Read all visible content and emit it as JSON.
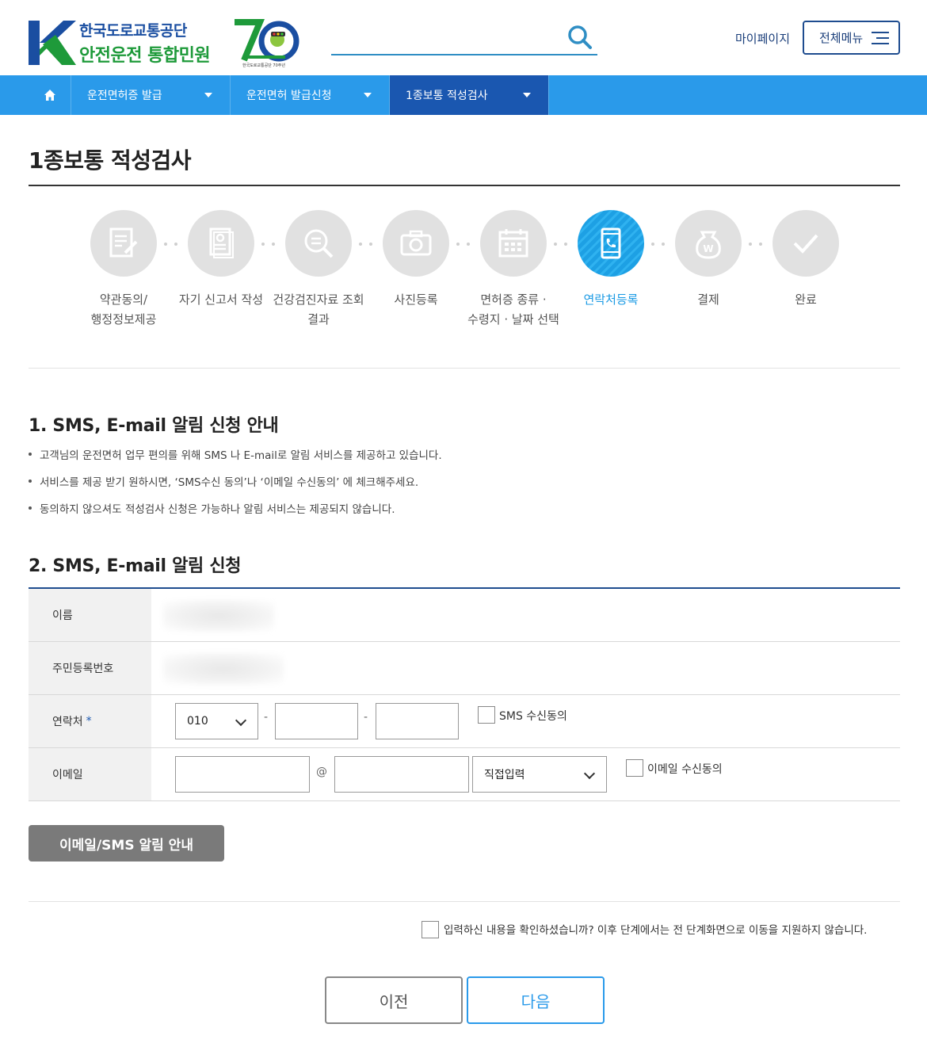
{
  "header": {
    "org_name": "한국도로교통공단",
    "service_name": "안전운전 통합민원",
    "anniversary_small": "한국도로교통공단 70주년",
    "search": {
      "value": "",
      "placeholder": ""
    },
    "mypage_label": "마이페이지",
    "allmenu_label": "전체메뉴"
  },
  "nav": {
    "items": [
      {
        "label": "운전면허증 발급"
      },
      {
        "label": "운전면허 발급신청"
      },
      {
        "label": "1종보통 적성검사"
      }
    ]
  },
  "page_title": "1종보통 적성검사",
  "steps": [
    {
      "label_line1": "약관동의/",
      "label_line2": "행정정보제공",
      "icon": "document-pen-icon"
    },
    {
      "label_line1": "자기 신고서 작성",
      "label_line2": "",
      "icon": "form-person-icon"
    },
    {
      "label_line1": "건강검진자료 조회",
      "label_line2": "결과",
      "icon": "search-document-icon"
    },
    {
      "label_line1": "사진등록",
      "label_line2": "",
      "icon": "camera-icon"
    },
    {
      "label_line1": "면허증 종류 ·",
      "label_line2": "수령지 · 날짜 선택",
      "icon": "calendar-icon"
    },
    {
      "label_line1": "연락처등록",
      "label_line2": "",
      "icon": "phone-icon"
    },
    {
      "label_line1": "결제",
      "label_line2": "",
      "icon": "won-bag-icon"
    },
    {
      "label_line1": "완료",
      "label_line2": "",
      "icon": "check-icon"
    }
  ],
  "active_step": 6,
  "section1": {
    "title": "1. SMS, E-mail 알림 신청 안내",
    "bullets": [
      "고객님의 운전면허 업무 편의를 위해 SMS 나 E-mail로 알림 서비스를 제공하고 있습니다.",
      "서비스를 제공 받기 원하시면, ‘SMS수신 동의’나 ‘이메일 수신동의’ 에 체크해주세요.",
      "동의하지 않으셔도 적성검사 신청은 가능하나 알림 서비스는 제공되지 않습니다."
    ]
  },
  "section2": {
    "title": "2. SMS, E-mail 알림 신청",
    "name_label": "이름",
    "rrn_label": "주민등록번호",
    "phone_label": "연락처",
    "required_mark": "*",
    "phone_prefix": "010",
    "phone_mid": "",
    "phone_last": "",
    "phone_sep": "-",
    "sms_consent_label": "SMS 수신동의",
    "email_label": "이메일",
    "email_id": "",
    "email_at": "@",
    "email_domain": "",
    "email_domain_select": "직접입력",
    "email_consent_label": "이메일 수신동의",
    "notice_button": "이메일/SMS 알림 안내"
  },
  "confirm_text": "입력하신 내용을 확인하셨습니까? 이후 단계에서는 전 단계화면으로 이동을 지원하지 않습니다.",
  "buttons": {
    "prev": "이전",
    "next": "다음"
  },
  "colors": {
    "primary": "#2a9aea",
    "nav_active": "#1a57b0",
    "brand_blue": "#1a4ea1",
    "brand_green": "#1e9a3a"
  }
}
